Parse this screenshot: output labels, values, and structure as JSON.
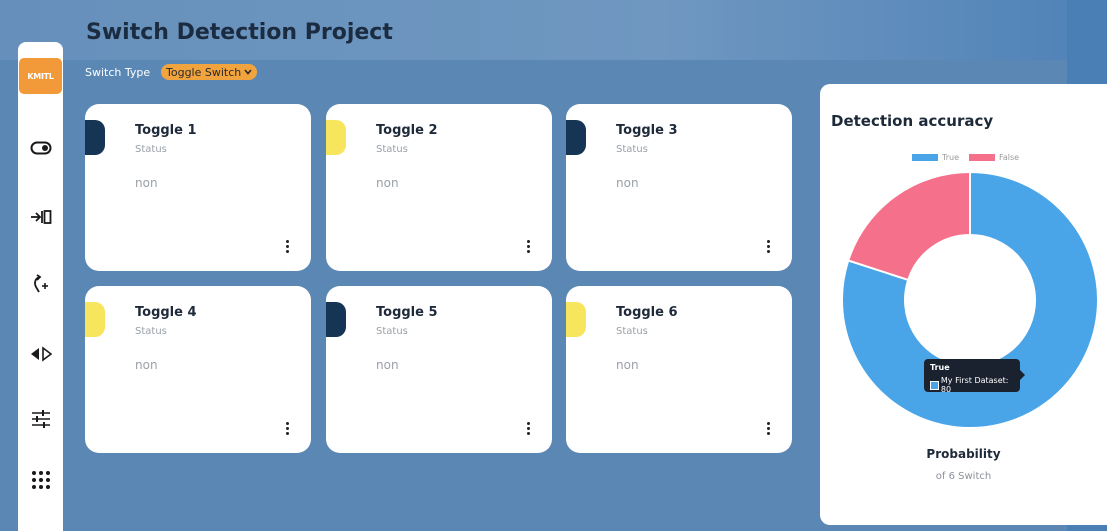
{
  "app": {
    "title": "Switch Detection Project",
    "logo_text": "KMITL"
  },
  "filter": {
    "label": "Switch Type",
    "selected": "Toggle Switch"
  },
  "sidebar": {
    "items": [
      {
        "name": "toggle-icon"
      },
      {
        "name": "login-icon"
      },
      {
        "name": "rotate-add-icon"
      },
      {
        "name": "arrows-left-right-icon"
      },
      {
        "name": "sliders-icon"
      },
      {
        "name": "grid-icon"
      }
    ]
  },
  "cards": [
    {
      "title": "Toggle 1",
      "status_label": "Status",
      "value": "non",
      "accent": "#163453"
    },
    {
      "title": "Toggle 2",
      "status_label": "Status",
      "value": "non",
      "accent": "#f7e55e"
    },
    {
      "title": "Toggle 3",
      "status_label": "Status",
      "value": "non",
      "accent": "#163453"
    },
    {
      "title": "Toggle 4",
      "status_label": "Status",
      "value": "non",
      "accent": "#f7e55e"
    },
    {
      "title": "Toggle 5",
      "status_label": "Status",
      "value": "non",
      "accent": "#163453"
    },
    {
      "title": "Toggle 6",
      "status_label": "Status",
      "value": "non",
      "accent": "#f7e55e"
    }
  ],
  "accuracy": {
    "title": "Detection accuracy",
    "legend": [
      {
        "label": "True",
        "color": "#4aa5e8"
      },
      {
        "label": "False",
        "color": "#f5708a"
      }
    ],
    "tooltip": {
      "title": "True",
      "text": "My First Dataset: 80"
    },
    "probability_label": "Probability",
    "probability_sub": "of 6 Switch"
  },
  "chart_data": {
    "type": "pie",
    "title": "Detection accuracy",
    "categories": [
      "True",
      "False"
    ],
    "series": [
      {
        "name": "My First Dataset",
        "values": [
          80,
          20
        ]
      }
    ],
    "colors": [
      "#4aa5e8",
      "#f5708a"
    ],
    "legend": "top"
  }
}
